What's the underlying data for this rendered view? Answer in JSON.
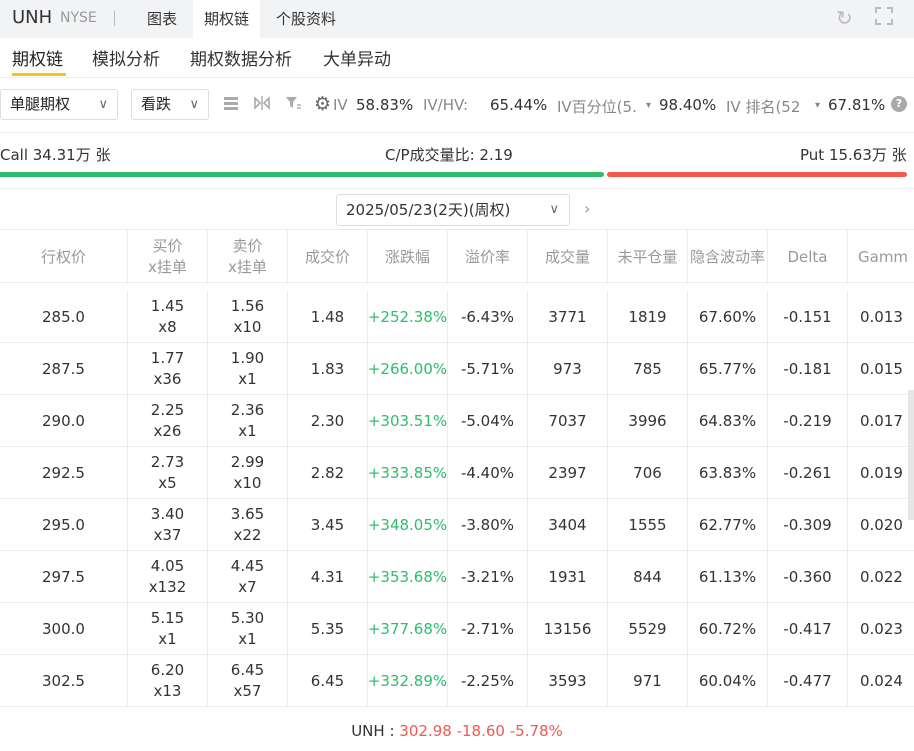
{
  "header": {
    "ticker": "UNH",
    "exchange": "NYSE",
    "tabs": [
      "图表",
      "期权链",
      "个股资料"
    ],
    "active_tab": "期权链"
  },
  "subtabs": [
    "期权链",
    "模拟分析",
    "期权数据分析",
    "大单异动"
  ],
  "filters": {
    "strategy": "单腿期权",
    "direction": "看跌"
  },
  "stats": {
    "iv_label": "IV",
    "iv_value": "58.83%",
    "ivhv_label": "IV/HV:",
    "ivhv_value": "65.44%",
    "ivpct_label": "IV百分位(5.",
    "ivpct_value": "98.40%",
    "ivrank_label": "IV 排名(52",
    "ivrank_value": "67.81%"
  },
  "volume": {
    "call": "Call 34.31万 张",
    "ratio": "C/P成交量比:  2.19",
    "put": "Put 15.63万 张"
  },
  "expiry": "2025/05/23(2天)(周权)",
  "columns": [
    "行权价",
    "买价\nx挂单",
    "卖价\nx挂单",
    "成交价",
    "涨跌幅",
    "溢价率",
    "成交量",
    "未平仓量",
    "隐含波动率",
    "Delta",
    "Gamm"
  ],
  "rows": [
    {
      "strike": "285.0",
      "bid": "1.45",
      "bid_size": "x8",
      "ask": "1.56",
      "ask_size": "x10",
      "last": "1.48",
      "chg": "+252.38%",
      "premium": "-6.43%",
      "volume": "3771",
      "oi": "1819",
      "iv": "67.60%",
      "delta": "-0.151",
      "gamma": "0.013"
    },
    {
      "strike": "287.5",
      "bid": "1.77",
      "bid_size": "x36",
      "ask": "1.90",
      "ask_size": "x1",
      "last": "1.83",
      "chg": "+266.00%",
      "premium": "-5.71%",
      "volume": "973",
      "oi": "785",
      "iv": "65.77%",
      "delta": "-0.181",
      "gamma": "0.015"
    },
    {
      "strike": "290.0",
      "bid": "2.25",
      "bid_size": "x26",
      "ask": "2.36",
      "ask_size": "x1",
      "last": "2.30",
      "chg": "+303.51%",
      "premium": "-5.04%",
      "volume": "7037",
      "oi": "3996",
      "iv": "64.83%",
      "delta": "-0.219",
      "gamma": "0.017"
    },
    {
      "strike": "292.5",
      "bid": "2.73",
      "bid_size": "x5",
      "ask": "2.99",
      "ask_size": "x10",
      "last": "2.82",
      "chg": "+333.85%",
      "premium": "-4.40%",
      "volume": "2397",
      "oi": "706",
      "iv": "63.83%",
      "delta": "-0.261",
      "gamma": "0.019"
    },
    {
      "strike": "295.0",
      "bid": "3.40",
      "bid_size": "x37",
      "ask": "3.65",
      "ask_size": "x22",
      "last": "3.45",
      "chg": "+348.05%",
      "premium": "-3.80%",
      "volume": "3404",
      "oi": "1555",
      "iv": "62.77%",
      "delta": "-0.309",
      "gamma": "0.020"
    },
    {
      "strike": "297.5",
      "bid": "4.05",
      "bid_size": "x132",
      "ask": "4.45",
      "ask_size": "x7",
      "last": "4.31",
      "chg": "+353.68%",
      "premium": "-3.21%",
      "volume": "1931",
      "oi": "844",
      "iv": "61.13%",
      "delta": "-0.360",
      "gamma": "0.022"
    },
    {
      "strike": "300.0",
      "bid": "5.15",
      "bid_size": "x1",
      "ask": "5.30",
      "ask_size": "x1",
      "last": "5.35",
      "chg": "+377.68%",
      "premium": "-2.71%",
      "volume": "13156",
      "oi": "5529",
      "iv": "60.72%",
      "delta": "-0.417",
      "gamma": "0.023"
    },
    {
      "strike": "302.5",
      "bid": "6.20",
      "bid_size": "x13",
      "ask": "6.45",
      "ask_size": "x57",
      "last": "6.45",
      "chg": "+332.89%",
      "premium": "-2.25%",
      "volume": "3593",
      "oi": "971",
      "iv": "60.04%",
      "delta": "-0.477",
      "gamma": "0.024"
    }
  ],
  "footer": {
    "label": "UNH :",
    "price": "302.98",
    "change": "-18.60",
    "change_pct": "-5.78%"
  },
  "colors": {
    "accent": "#f5c518",
    "up": "#2ebd6d",
    "down": "#f05a4f"
  }
}
